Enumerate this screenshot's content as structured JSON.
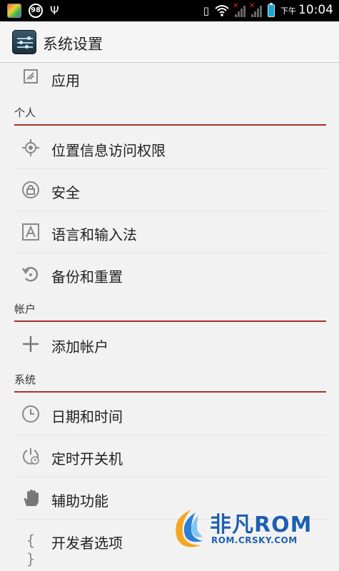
{
  "status_bar": {
    "notification_badge": "98",
    "clock_ampm": "下午",
    "clock_time": "10:04",
    "icons": [
      "app-notification-icon",
      "usb-icon",
      "vibrate-icon",
      "wifi-icon",
      "signal-icon",
      "battery-icon"
    ]
  },
  "action_bar": {
    "title": "系统设置"
  },
  "items": {
    "apps": "应用",
    "location": "位置信息访问权限",
    "security": "安全",
    "language": "语言和输入法",
    "backup": "备份和重置",
    "add_account": "添加帐户",
    "date_time": "日期和时间",
    "schedule_power": "定时开关机",
    "accessibility": "辅助功能",
    "developer": "开发者选项"
  },
  "sections": {
    "personal": "个人",
    "accounts": "帐户",
    "system": "系统"
  },
  "watermark": {
    "brand": "非凡ROM",
    "url": "ROM.CRSKY.COM"
  },
  "colors": {
    "section_line": "#a6302c",
    "background": "#f2f2f2"
  }
}
